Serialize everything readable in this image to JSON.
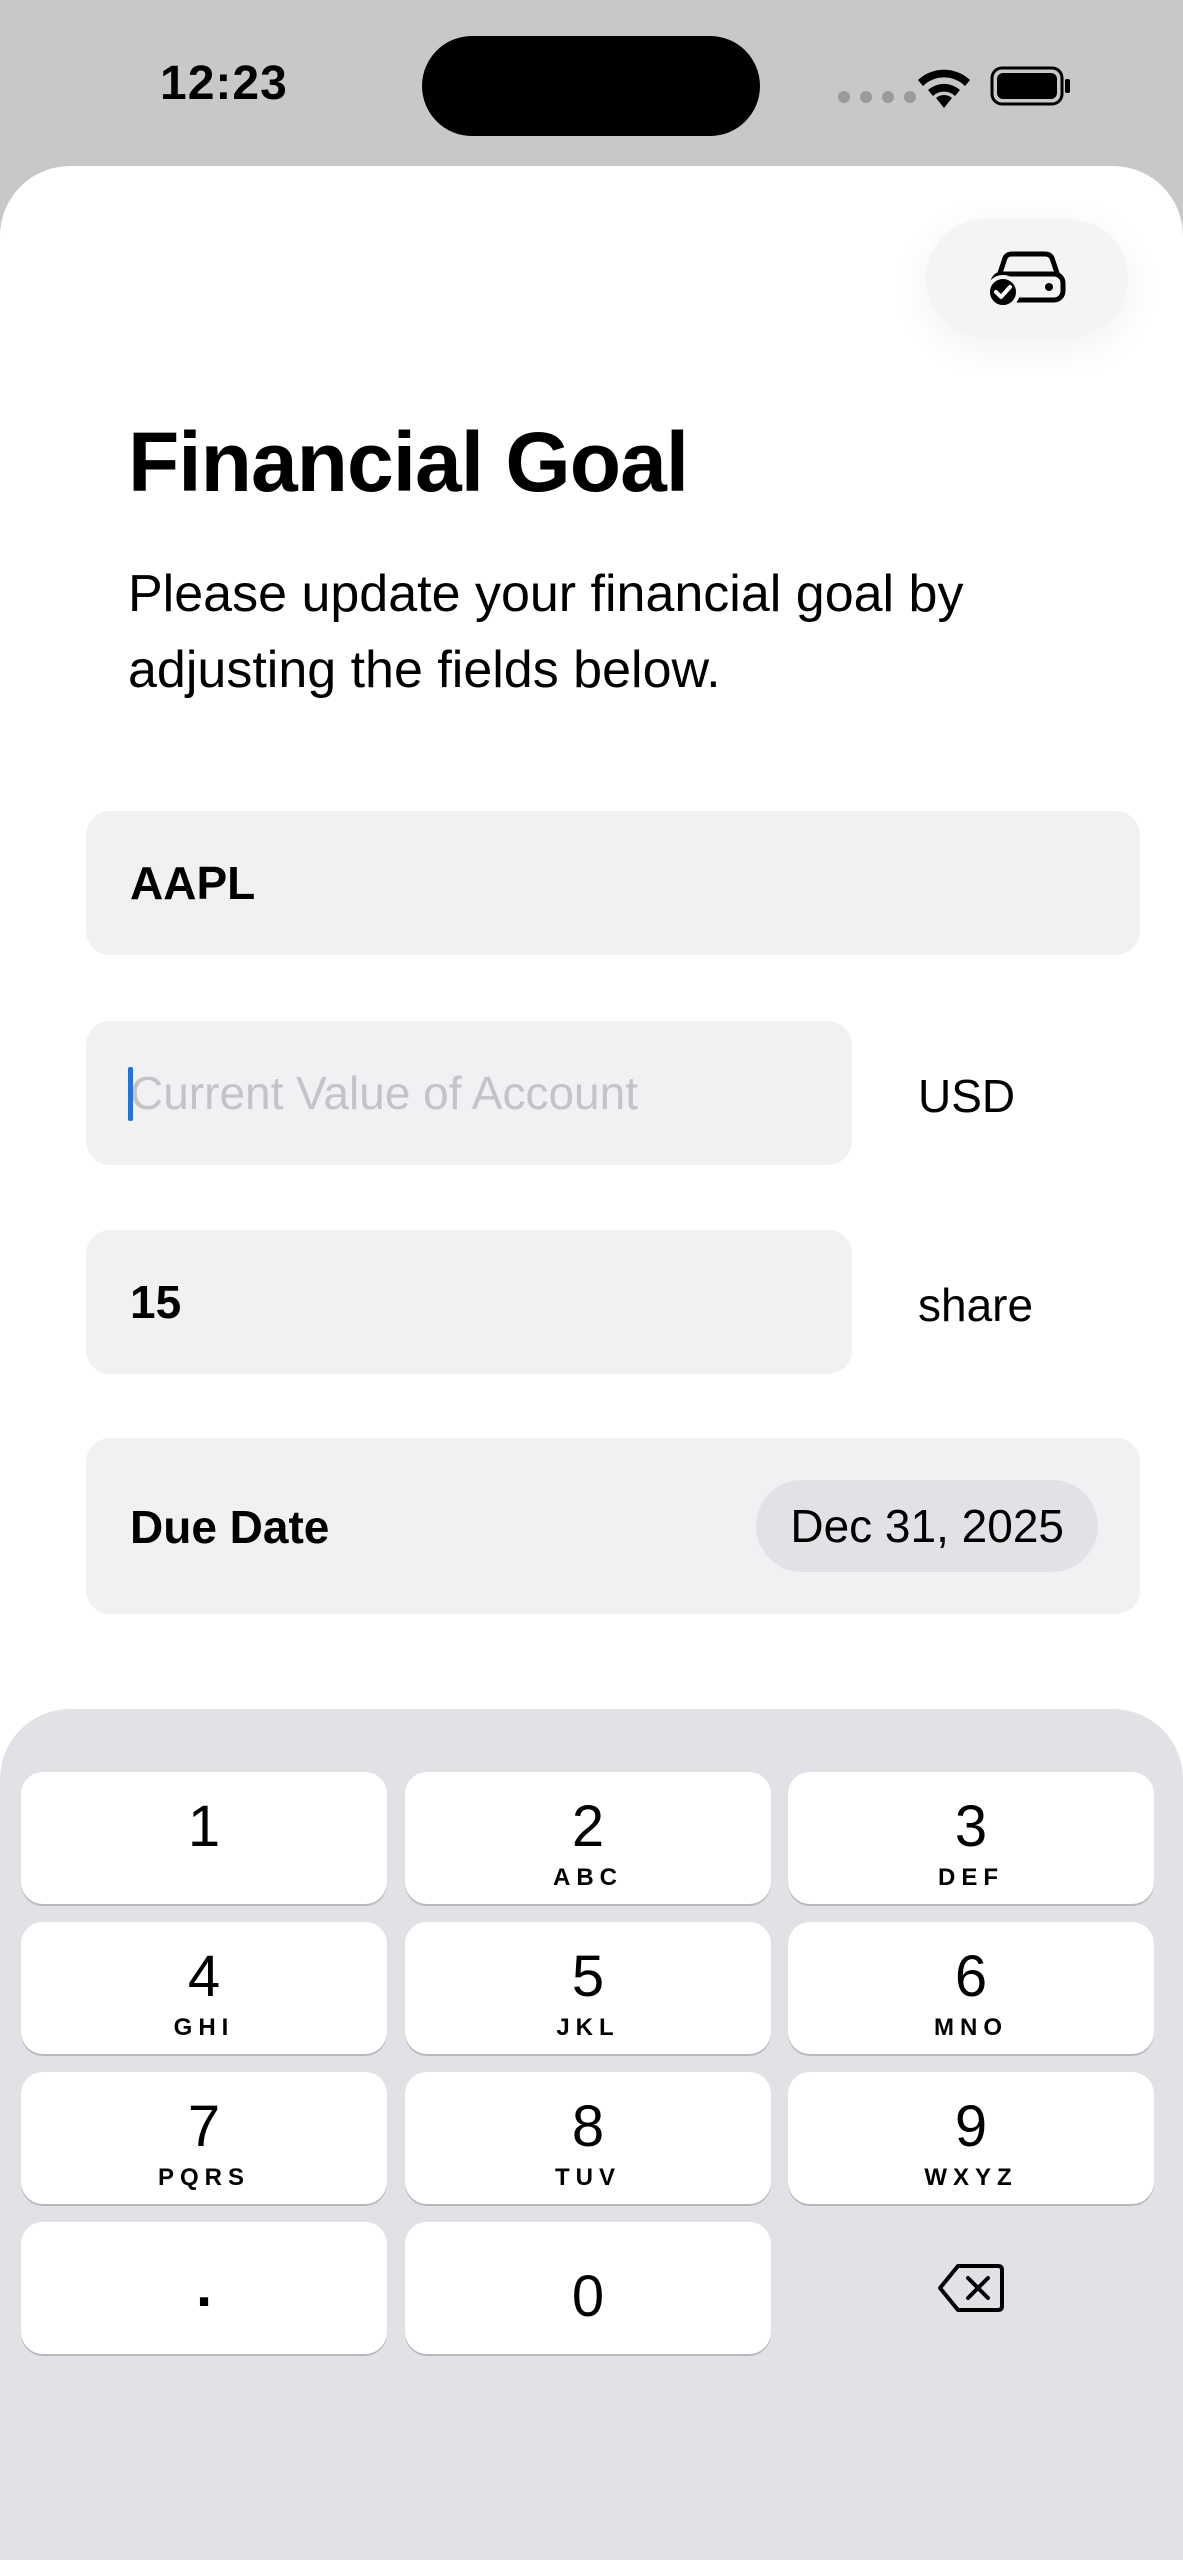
{
  "status_bar": {
    "time": "12:23",
    "icons": [
      "signal-dots-icon",
      "wifi-icon",
      "battery-icon"
    ]
  },
  "header": {
    "action_icon": "car-check-icon"
  },
  "page": {
    "title": "Financial Goal",
    "subtitle": "Please update your financial goal by adjusting the fields below."
  },
  "form": {
    "ticker": {
      "value": "AAPL"
    },
    "account_value": {
      "value": "",
      "placeholder": "Current Value of Account",
      "unit": "USD"
    },
    "shares": {
      "value": "15",
      "unit": "share"
    },
    "due_date": {
      "label": "Due Date",
      "value": "Dec 31, 2025"
    }
  },
  "keyboard": {
    "keys": [
      {
        "digit": "1",
        "letters": ""
      },
      {
        "digit": "2",
        "letters": "ABC"
      },
      {
        "digit": "3",
        "letters": "DEF"
      },
      {
        "digit": "4",
        "letters": "GHI"
      },
      {
        "digit": "5",
        "letters": "JKL"
      },
      {
        "digit": "6",
        "letters": "MNO"
      },
      {
        "digit": "7",
        "letters": "PQRS"
      },
      {
        "digit": "8",
        "letters": "TUV"
      },
      {
        "digit": "9",
        "letters": "WXYZ"
      },
      {
        "digit": ".",
        "letters": ""
      },
      {
        "digit": "0",
        "letters": ""
      }
    ],
    "delete_icon": "delete-backward-icon"
  },
  "colors": {
    "cursor": "#1a73e8",
    "field_background": "#f1f1f3",
    "keyboard_background": "#e1e2e6"
  }
}
